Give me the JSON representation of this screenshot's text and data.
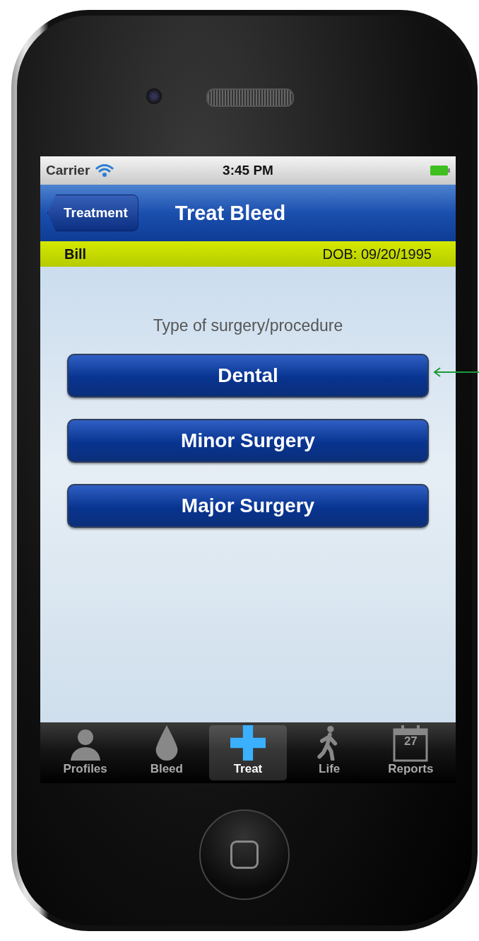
{
  "status_bar": {
    "carrier": "Carrier",
    "time": "3:45 PM"
  },
  "nav_bar": {
    "back": "Treatment",
    "title": "Treat Bleed"
  },
  "patient_bar": {
    "name": "Bill",
    "dob": "DOB: 09/20/1995"
  },
  "prompt": "Type of surgery/procedure",
  "options": [
    {
      "label": "Dental",
      "pointed": true
    },
    {
      "label": "Minor Surgery",
      "pointed": false
    },
    {
      "label": "Major Surgery",
      "pointed": false
    }
  ],
  "tabs": [
    {
      "label": "Profiles",
      "kind": "person",
      "selected": false
    },
    {
      "label": "Bleed",
      "kind": "drop",
      "selected": false
    },
    {
      "label": "Treat",
      "kind": "cross",
      "selected": true
    },
    {
      "label": "Life",
      "kind": "walker",
      "selected": false
    },
    {
      "label": "Reports",
      "kind": "calendar",
      "icon_text": "27",
      "selected": false
    }
  ]
}
